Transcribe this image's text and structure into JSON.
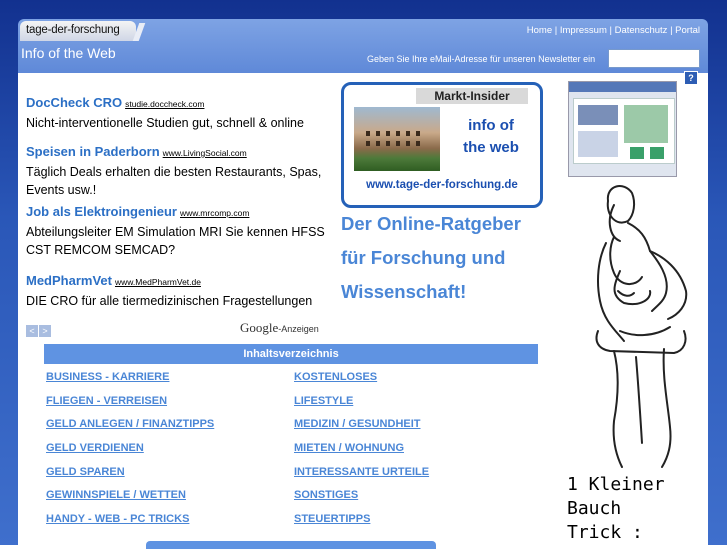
{
  "header": {
    "logo_text": "tage-der-forschung",
    "tagline": "Info of the Web",
    "nav": [
      "Home",
      "Impressum",
      "Datenschutz",
      "Portal"
    ],
    "newsletter_label": "Geben Sie Ihre eMail-Adresse für unseren Newsletter ein",
    "newsletter_placeholder": "",
    "help_label": "?"
  },
  "ads": [
    {
      "title": "DocCheck CRO",
      "url": "studie.doccheck.com",
      "desc": "Nicht-interventionelle Studien gut, schnell & online"
    },
    {
      "title": "Speisen in Paderborn",
      "url": "www.LivingSocial.com",
      "desc": "Täglich Deals erhalten die besten Restaurants, Spas, Events usw.!"
    },
    {
      "title": "Job als Elektroingenieur",
      "url": "www.mrcomp.com",
      "desc": "Abteilungsleiter EM Simulation MRI Sie kennen HFSS CST REMCOM SEMCAD?"
    },
    {
      "title": "MedPharmVet",
      "url": "www.MedPharmVet.de",
      "desc": "DIE CRO für alle tiermedizinischen Fragestellungen"
    }
  ],
  "ads_nav": {
    "prev": "<",
    "next": ">"
  },
  "google": {
    "brand": "Google",
    "suffix": "-Anzeigen"
  },
  "promo": {
    "head": "Markt-Insider",
    "side_line1": "info of",
    "side_line2": "the web",
    "url": "www.tage-der-forschung.de"
  },
  "ratgeber": {
    "line1": "Der Online-Ratgeber",
    "line2": "für Forschung und",
    "line3": "Wissenschaft!"
  },
  "right_ad": {
    "line1": "1 Kleiner Bauch",
    "line2": "Trick :"
  },
  "index": {
    "title": "Inhaltsverzeichnis",
    "left": [
      "BUSINESS - KARRIERE",
      "FLIEGEN - VERREISEN",
      "GELD ANLEGEN / FINANZTIPPS",
      "GELD VERDIENEN",
      "GELD SPAREN",
      "GEWINNSPIELE / WETTEN",
      "HANDY - WEB - PC TRICKS"
    ],
    "right": [
      "KOSTENLOSES",
      "LIFESTYLE",
      "MEDIZIN / GESUNDHEIT",
      "MIETEN / WOHNUNG",
      "INTERESSANTE URTEILE",
      "SONSTIGES",
      "STEUERTIPPS"
    ]
  },
  "colors": {
    "frame": "#2a57b8",
    "link": "#4a86d6",
    "ad_title": "#2b6fc5",
    "index_bar": "#5f93e2"
  }
}
